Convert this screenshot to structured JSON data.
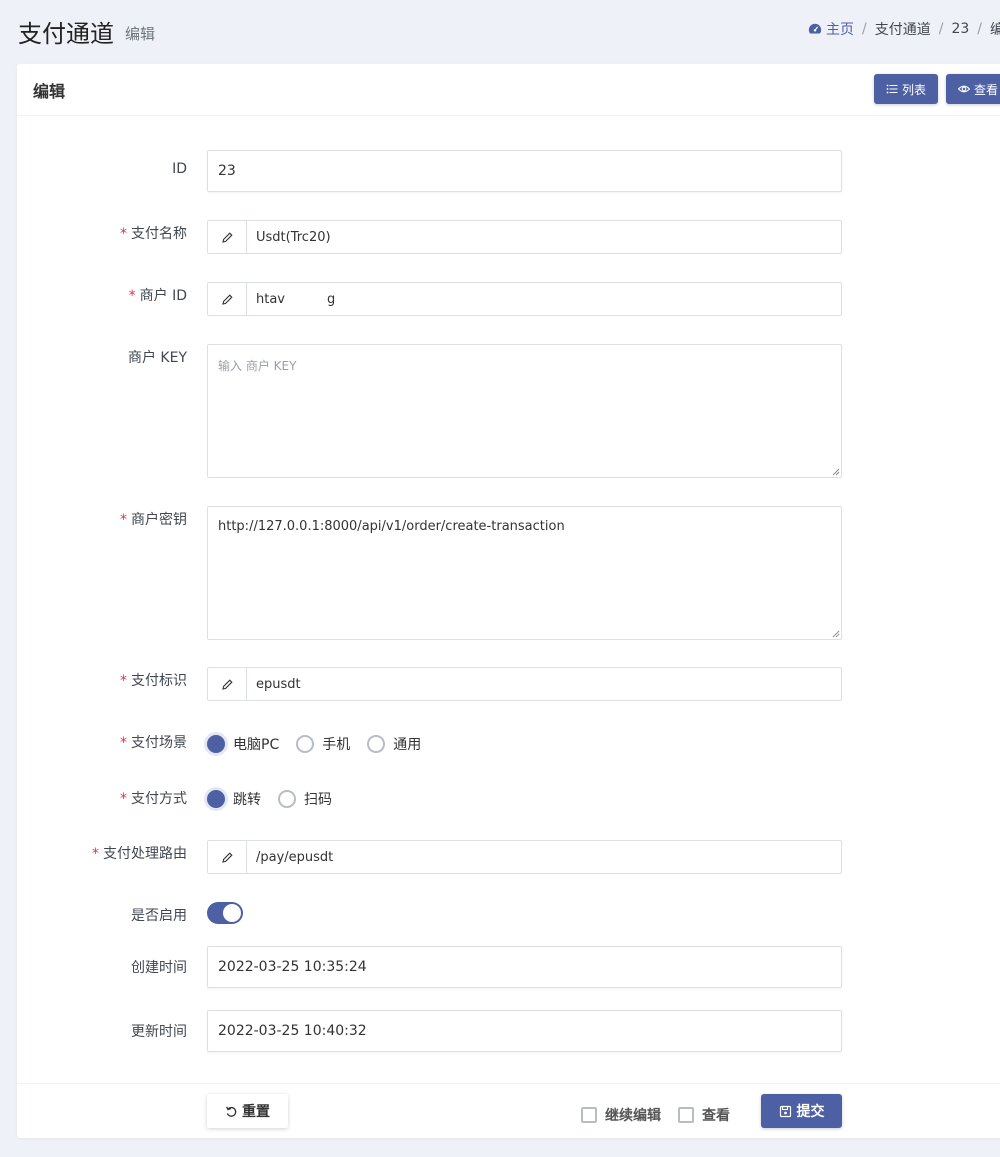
{
  "header": {
    "title": "支付通道",
    "subtitle": "编辑",
    "breadcrumb": {
      "home": "主页",
      "section": "支付通道",
      "id": "23",
      "current": "编辑"
    }
  },
  "card": {
    "title": "编辑",
    "list_button": "列表",
    "view_button": "查看"
  },
  "form": {
    "id_label": "ID",
    "id_value": "23",
    "pay_name_label": "支付名称",
    "pay_name_value": "Usdt(Trc20)",
    "merchant_id_label": "商户 ID",
    "merchant_id_value": "htav",
    "merchant_id_tail": "g",
    "merchant_key_label": "商户 KEY",
    "merchant_key_placeholder": "输入 商户 KEY",
    "merchant_secret_label": "商户密钥",
    "merchant_secret_value": "http://127.0.0.1:8000/api/v1/order/create-transaction",
    "pay_check_label": "支付标识",
    "pay_check_value": "epusdt",
    "pay_scene_label": "支付场景",
    "pay_scene_options": [
      "电脑PC",
      "手机",
      "通用"
    ],
    "pay_method_label": "支付方式",
    "pay_method_options": [
      "跳转",
      "扫码"
    ],
    "pay_route_label": "支付处理路由",
    "pay_route_value": "/pay/epusdt",
    "enabled_label": "是否启用",
    "enabled": true,
    "created_label": "创建时间",
    "created_value": "2022-03-25 10:35:24",
    "updated_label": "更新时间",
    "updated_value": "2022-03-25 10:40:32"
  },
  "footer": {
    "reset_label": "重置",
    "continue_edit_label": "继续编辑",
    "view_label": "查看",
    "submit_label": "提交"
  },
  "colors": {
    "primary": "#4c60a3",
    "required": "#dc3545",
    "background": "#eff1f8"
  }
}
